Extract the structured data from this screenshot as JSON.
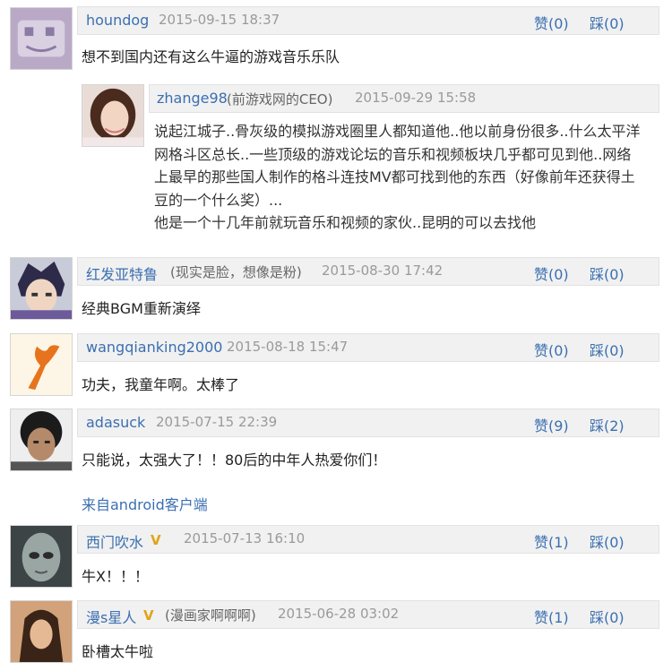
{
  "comments": [
    {
      "user": "houndog",
      "time": "2015-09-15 18:37",
      "up": "赞(0)",
      "down": "踩(0)",
      "text": "想不到国内还有这么牛逼的游戏音乐乐队",
      "reply": {
        "user": "zhange98",
        "note": "(前游戏网的CEO)",
        "time": "2015-09-29 15:58",
        "lines": [
          "说起江城子..骨灰级的模拟游戏圈里人都知道他..他以前身份很多..什么太平洋",
          "网格斗区总长..一些顶级的游戏论坛的音乐和视频板块几乎都可见到他..网络",
          "上最早的那些国人制作的格斗连技MV都可找到他的东西（好像前年还获得土",
          "豆的一个什么奖）...",
          "他是一个十几年前就玩音乐和视频的家伙..昆明的可以去找他"
        ]
      }
    },
    {
      "user": "红发亚特鲁",
      "note": "(现实是脸，想像是粉)",
      "time": "2015-08-30 17:42",
      "up": "赞(0)",
      "down": "踩(0)",
      "text": "经典BGM重新演绎"
    },
    {
      "user": "wangqianking2000",
      "time": "2015-08-18 15:47",
      "up": "赞(0)",
      "down": "踩(0)",
      "text": "功夫，我童年啊。太棒了"
    },
    {
      "user": "adasuck",
      "time": "2015-07-15 22:39",
      "up": "赞(9)",
      "down": "踩(2)",
      "text": "只能说，太强大了！！80后的中年人热爱你们！",
      "client": "来自android客户端"
    },
    {
      "user": "西门吹水",
      "vip": "V",
      "time": "2015-07-13 16:10",
      "up": "赞(1)",
      "down": "踩(0)",
      "text": "牛X！！！"
    },
    {
      "user": "漫s星人",
      "vip": "V",
      "note": "(漫画家啊啊啊)",
      "time": "2015-06-28 03:02",
      "up": "赞(1)",
      "down": "踩(0)",
      "text": "卧槽太牛啦"
    }
  ],
  "avatars": [
    "houndog-avatar",
    "woman-photo-avatar",
    "anime-boy-avatar",
    "lobster-claw-avatar",
    "curly-hair-man-avatar",
    "alien-avatar",
    "girl-art-avatar"
  ]
}
